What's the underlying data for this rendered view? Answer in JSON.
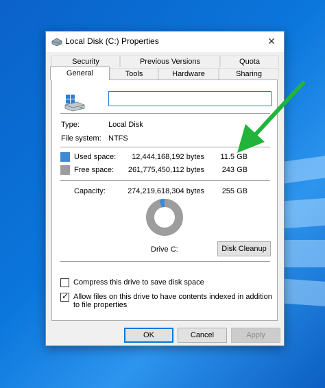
{
  "window": {
    "title": "Local Disk (C:) Properties",
    "close_glyph": "✕"
  },
  "tabs_row1": [
    {
      "label": "Security"
    },
    {
      "label": "Previous Versions"
    },
    {
      "label": "Quota"
    }
  ],
  "tabs_row2": [
    {
      "label": "General"
    },
    {
      "label": "Tools"
    },
    {
      "label": "Hardware"
    },
    {
      "label": "Sharing"
    }
  ],
  "general": {
    "name_value": "",
    "type_label": "Type:",
    "type_value": "Local Disk",
    "fs_label": "File system:",
    "fs_value": "NTFS",
    "used": {
      "label": "Used space:",
      "bytes": "12,444,168,192 bytes",
      "size": "11.5 GB",
      "color": "#3b8ad8"
    },
    "free": {
      "label": "Free space:",
      "bytes": "261,775,450,112 bytes",
      "size": "243 GB",
      "color": "#9d9d9d"
    },
    "capacity": {
      "label": "Capacity:",
      "bytes": "274,219,618,304 bytes",
      "size": "255 GB"
    },
    "used_fraction": 0.0454,
    "drive_label": "Drive C:",
    "cleanup_label": "Disk Cleanup",
    "compress_label": "Compress this drive to save disk space",
    "compress_checked": false,
    "index_label_1": "Allow files on this drive to have contents indexed in addition",
    "index_label_2": "to file properties",
    "index_checked": true
  },
  "buttons": {
    "ok": "OK",
    "cancel": "Cancel",
    "apply": "Apply"
  },
  "annotation": {
    "color": "#22b43a"
  }
}
